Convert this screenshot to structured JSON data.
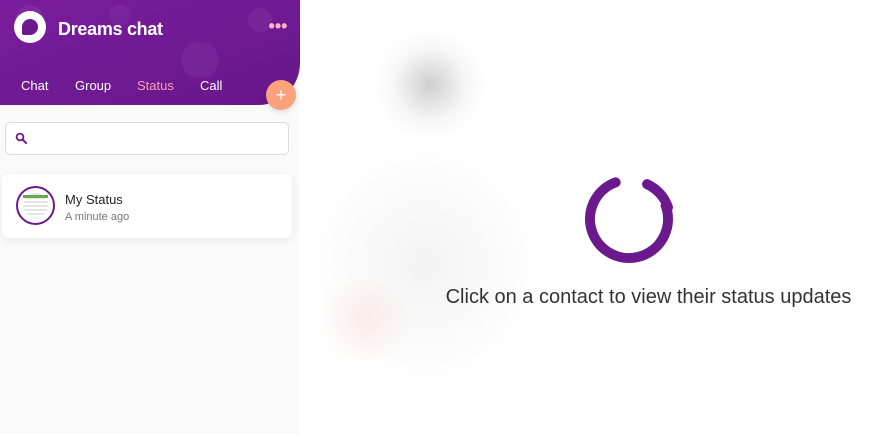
{
  "app": {
    "name": "Dreams chat"
  },
  "header": {
    "more_icon": "more-dots-icon",
    "more_label": "•••"
  },
  "tabs": [
    {
      "label": "Chat",
      "active": false
    },
    {
      "label": "Group",
      "active": false
    },
    {
      "label": "Status",
      "active": true
    },
    {
      "label": "Call",
      "active": false
    }
  ],
  "add_button": {
    "label": "+",
    "icon": "plus-icon"
  },
  "search": {
    "value": "",
    "placeholder": "",
    "icon": "search-icon"
  },
  "status_list": [
    {
      "name": "My Status",
      "time": "A minute ago"
    }
  ],
  "main": {
    "message": "Click on a contact to view their status updates",
    "loader_icon": "loading-spinner-icon"
  },
  "colors": {
    "brand": "#6b1a8e",
    "active_tab": "#ff9eb4",
    "fab": "#fba27c"
  }
}
